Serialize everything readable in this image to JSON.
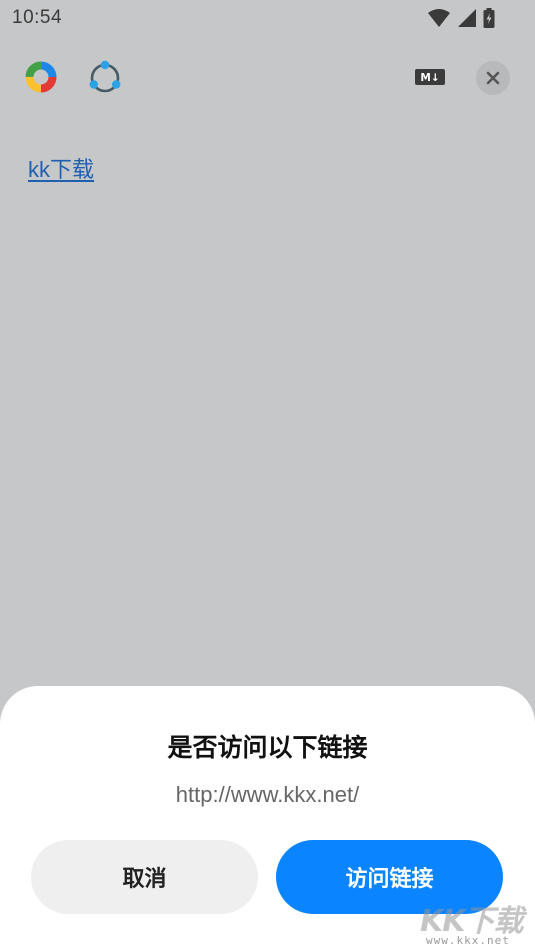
{
  "status_bar": {
    "time": "10:54",
    "icons": [
      "wifi-icon",
      "signal-icon",
      "battery-charging-icon"
    ]
  },
  "toolbar": {
    "logo_icon": "color-ring-logo-icon",
    "share_icon": "share-nodes-icon",
    "markdown_icon": "markdown-icon",
    "markdown_label": "M↓",
    "close_icon": "close-icon"
  },
  "content": {
    "link_text": "kk下载"
  },
  "dialog": {
    "title": "是否访问以下链接",
    "url": "http://www.kkx.net/",
    "cancel_label": "取消",
    "visit_label": "访问链接"
  },
  "watermark": {
    "big": "KK下载",
    "small": "www.kkx.net"
  },
  "colors": {
    "background": "#c6c7c8",
    "link": "#1f5fb0",
    "primary_button": "#0a84ff",
    "secondary_button": "#efefef"
  }
}
